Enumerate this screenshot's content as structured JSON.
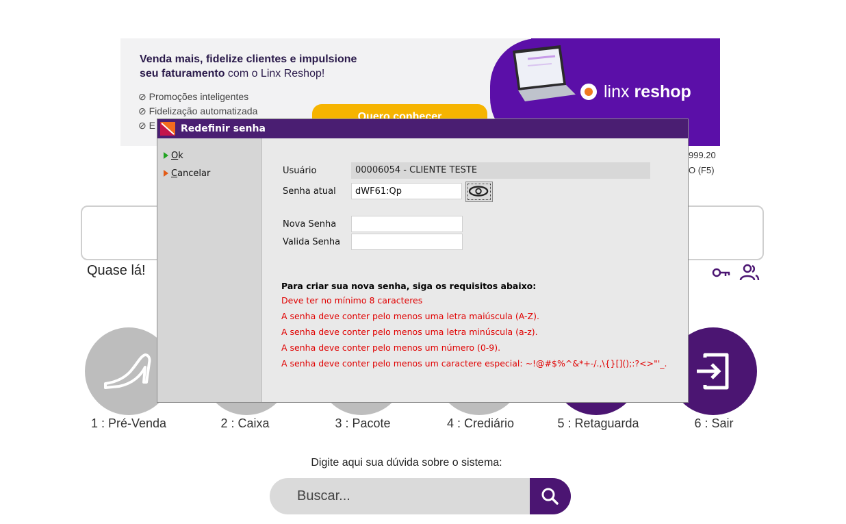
{
  "banner": {
    "headline_bold": "Venda mais, fidelize clientes e impulsione",
    "headline_bold2": "seu faturamento",
    "headline_rest": " com o Linx Reshop!",
    "bullets": [
      "Promoções inteligentes",
      "Fidelização automatizada",
      "E"
    ],
    "cta": "Quero conhecer",
    "brand_light": "linx ",
    "brand_bold": "reshop",
    "colors": {
      "purple": "#5b0fa8",
      "cta": "#f6b400"
    }
  },
  "background": {
    "value": "999.20",
    "f5": "O (F5)",
    "status_text": "Quase lá!",
    "menu": [
      {
        "label": "1 : Pré-Venda",
        "icon": "shoe-icon"
      },
      {
        "label": "2 : Caixa",
        "icon": ""
      },
      {
        "label": "3 : Pacote",
        "icon": ""
      },
      {
        "label": "4 : Crediário",
        "icon": ""
      },
      {
        "label": "5 : Retaguarda",
        "icon": ""
      },
      {
        "label": "6 : Sair",
        "icon": "exit-icon"
      }
    ],
    "help_text": "Digite aqui sua dúvida sobre o sistema:",
    "search_placeholder": "Buscar..."
  },
  "dialog": {
    "title": "Redefinir senha",
    "actions": {
      "ok_key": "O",
      "ok_rest": "k",
      "cancel_key": "C",
      "cancel_rest": "ancelar"
    },
    "labels": {
      "usuario": "Usuário",
      "senha_atual": "Senha atual",
      "nova_senha": "Nova Senha",
      "valida_senha": "Valida Senha"
    },
    "values": {
      "usuario": "00006054 - CLIENTE TESTE",
      "senha_atual": "dWF61:Qp",
      "nova_senha": "",
      "valida_senha": ""
    },
    "requirements_title": "Para criar sua nova senha, siga os requisitos abaixo:",
    "requirements": [
      "Deve ter no mínimo 8 caracteres",
      "A senha deve conter pelo menos uma letra maiúscula (A-Z).",
      "A senha deve conter pelo menos uma letra minúscula (a-z).",
      "A senha deve conter pelo menos um número (0-9).",
      "A senha deve conter pelo menos um caractere especial: ~!@#$%^&*+-/.,\\{}[]();:?<>\"'_."
    ],
    "colors": {
      "titlebar": "#4a1e72",
      "requirement": "#e00000"
    }
  }
}
